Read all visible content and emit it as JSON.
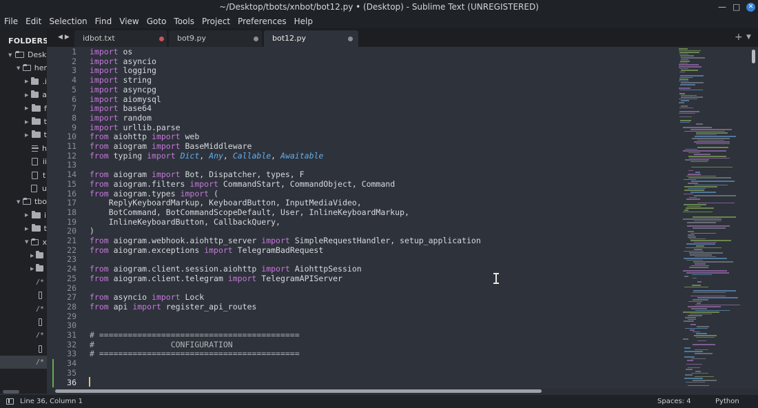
{
  "window": {
    "title": "~/Desktop/tbots/xnbot/bot12.py • (Desktop) - Sublime Text (UNREGISTERED)",
    "minimize_glyph": "—",
    "maximize_glyph": "□",
    "close_glyph": "✕"
  },
  "menu": [
    "File",
    "Edit",
    "Selection",
    "Find",
    "View",
    "Goto",
    "Tools",
    "Project",
    "Preferences",
    "Help"
  ],
  "sidebar": {
    "title": "FOLDERS",
    "items": [
      {
        "label": "Desk",
        "icon": "folder-open-icon"
      },
      {
        "label": "her",
        "icon": "folder-open-icon"
      },
      {
        "label": ".i",
        "icon": "folder-icon"
      },
      {
        "label": "a",
        "icon": "folder-icon"
      },
      {
        "label": "f",
        "icon": "folder-icon"
      },
      {
        "label": "t",
        "icon": "folder-icon"
      },
      {
        "label": "t",
        "icon": "folder-icon"
      },
      {
        "label": "h",
        "icon": "text-file-icon"
      },
      {
        "label": "ii",
        "icon": "file-icon"
      },
      {
        "label": "t",
        "icon": "file-icon"
      },
      {
        "label": "u",
        "icon": "file-icon"
      },
      {
        "label": "tbo",
        "icon": "folder-open-icon"
      },
      {
        "label": "i",
        "icon": "folder-icon"
      },
      {
        "label": "t",
        "icon": "folder-icon"
      },
      {
        "label": "x",
        "icon": "folder-open-icon"
      },
      {
        "label": "",
        "icon": "folder-icon"
      },
      {
        "label": "",
        "icon": "folder-icon"
      },
      {
        "label": "/*",
        "icon": "code-file-icon"
      },
      {
        "label": "",
        "icon": "file-icon"
      },
      {
        "label": "/*",
        "icon": "code-file-icon"
      },
      {
        "label": "",
        "icon": "file-icon"
      },
      {
        "label": "/*",
        "icon": "code-file-icon"
      },
      {
        "label": "",
        "icon": "file-icon"
      },
      {
        "label": "/*",
        "icon": "code-file-icon"
      }
    ]
  },
  "tabs": [
    {
      "label": "idbot.txt",
      "modified": true
    },
    {
      "label": "bot9.py",
      "modified": true
    },
    {
      "label": "bot12.py",
      "modified": true,
      "active": true
    }
  ],
  "tab_controls": {
    "back": "◀",
    "forward": "▶",
    "new_tab": "+",
    "tab_list": "▼"
  },
  "editor": {
    "language": "Python",
    "current_line": 36,
    "lines": [
      "import os",
      "import asyncio",
      "import logging",
      "import string",
      "import asyncpg",
      "import aiomysql",
      "import base64",
      "import random",
      "import urllib.parse",
      "from aiohttp import web",
      "from aiogram import BaseMiddleware",
      "from typing import Dict, Any, Callable, Awaitable",
      "",
      "from aiogram import Bot, Dispatcher, types, F",
      "from aiogram.filters import CommandStart, CommandObject, Command",
      "from aiogram.types import (",
      "    ReplyKeyboardMarkup, KeyboardButton, InputMediaVideo,",
      "    BotCommand, BotCommandScopeDefault, User, InlineKeyboardMarkup,",
      "    InlineKeyboardButton, CallbackQuery,",
      ")",
      "from aiogram.webhook.aiohttp_server import SimpleRequestHandler, setup_application",
      "from aiogram.exceptions import TelegramBadRequest",
      "",
      "from aiogram.client.session.aiohttp import AiohttpSession",
      "from aiogram.client.telegram import TelegramAPIServer",
      "",
      "from asyncio import Lock",
      "from api import register_api_routes",
      "",
      "",
      "# ==========================================",
      "#                CONFIGURATION",
      "# ==========================================",
      "",
      "",
      ""
    ]
  },
  "status": {
    "position": "Line 36, Column 1",
    "indentation": "Spaces: 4",
    "syntax": "Python"
  },
  "colors": {
    "keyword": "#c678dd",
    "type": "#61afef",
    "text": "#d7dae0",
    "background": "#2e323a",
    "modified_marker": "#6aa84f"
  }
}
